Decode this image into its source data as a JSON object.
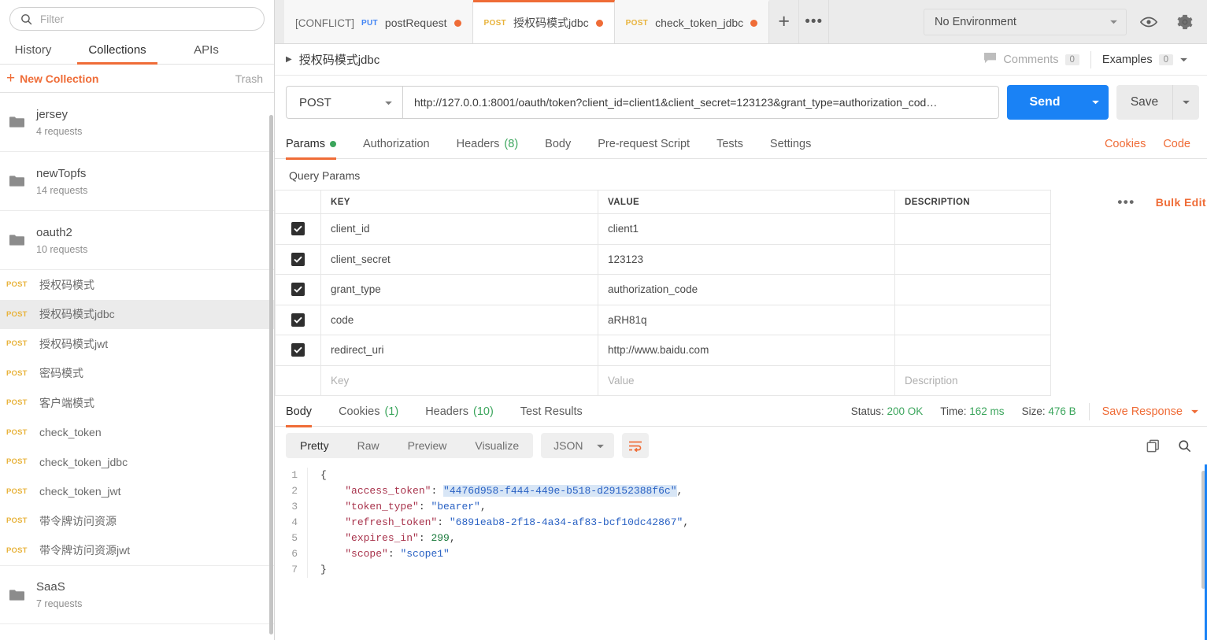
{
  "sidebar": {
    "filter_placeholder": "Filter",
    "tabs": [
      {
        "label": "History",
        "active": false
      },
      {
        "label": "Collections",
        "active": true
      },
      {
        "label": "APIs",
        "active": false
      }
    ],
    "new_collection_label": "New Collection",
    "trash_label": "Trash",
    "folders": [
      {
        "name": "jersey",
        "count": "4 requests"
      },
      {
        "name": "newTopfs",
        "count": "14 requests"
      },
      {
        "name": "oauth2",
        "count": "10 requests"
      }
    ],
    "requests": [
      {
        "method": "POST",
        "name": "授权码模式",
        "selected": false
      },
      {
        "method": "POST",
        "name": "授权码模式jdbc",
        "selected": true
      },
      {
        "method": "POST",
        "name": "授权码模式jwt",
        "selected": false
      },
      {
        "method": "POST",
        "name": "密码模式",
        "selected": false
      },
      {
        "method": "POST",
        "name": "客户端模式",
        "selected": false
      },
      {
        "method": "POST",
        "name": "check_token",
        "selected": false
      },
      {
        "method": "POST",
        "name": "check_token_jdbc",
        "selected": false
      },
      {
        "method": "POST",
        "name": "check_token_jwt",
        "selected": false
      },
      {
        "method": "POST",
        "name": "带令牌访问资源",
        "selected": false
      },
      {
        "method": "POST",
        "name": "带令牌访问资源jwt",
        "selected": false
      }
    ],
    "folders_after": [
      {
        "name": "SaaS",
        "count": "7 requests"
      }
    ]
  },
  "tabstrip": {
    "tabs": [
      {
        "prefix": "[CONFLICT]",
        "method": "PUT",
        "method_class": "put",
        "name": "postRequest",
        "active": false,
        "unsaved": true
      },
      {
        "prefix": "",
        "method": "POST",
        "method_class": "post",
        "name": "授权码模式jdbc",
        "active": true,
        "unsaved": true
      },
      {
        "prefix": "",
        "method": "POST",
        "method_class": "post",
        "name": "check_token_jdbc",
        "active": false,
        "unsaved": true
      }
    ],
    "add_tab_label": "+",
    "more_label": "•••",
    "environment": "No Environment"
  },
  "breadcrumb": {
    "title": "授权码模式jdbc",
    "comments_label": "Comments",
    "comments_count": "0",
    "examples_label": "Examples",
    "examples_count": "0"
  },
  "urlbar": {
    "method": "POST",
    "url": "http://127.0.0.1:8001/oauth/token?client_id=client1&client_secret=123123&grant_type=authorization_cod…",
    "send_label": "Send",
    "save_label": "Save"
  },
  "request_tabs": [
    {
      "label": "Params",
      "badge": "",
      "dot": true,
      "active": true
    },
    {
      "label": "Authorization",
      "badge": "",
      "dot": false,
      "active": false
    },
    {
      "label": "Headers",
      "badge": "(8)",
      "dot": false,
      "active": false
    },
    {
      "label": "Body",
      "badge": "",
      "dot": false,
      "active": false
    },
    {
      "label": "Pre-request Script",
      "badge": "",
      "dot": false,
      "active": false
    },
    {
      "label": "Tests",
      "badge": "",
      "dot": false,
      "active": false
    },
    {
      "label": "Settings",
      "badge": "",
      "dot": false,
      "active": false
    }
  ],
  "request_tabs_right": {
    "cookies": "Cookies",
    "code": "Code"
  },
  "params": {
    "section_label": "Query Params",
    "headers": {
      "key": "KEY",
      "value": "VALUE",
      "description": "DESCRIPTION"
    },
    "bulk_edit_label": "Bulk Edit",
    "rows": [
      {
        "checked": true,
        "key": "client_id",
        "value": "client1",
        "description": ""
      },
      {
        "checked": true,
        "key": "client_secret",
        "value": "123123",
        "description": ""
      },
      {
        "checked": true,
        "key": "grant_type",
        "value": "authorization_code",
        "description": ""
      },
      {
        "checked": true,
        "key": "code",
        "value": "aRH81q",
        "description": ""
      },
      {
        "checked": true,
        "key": "redirect_uri",
        "value": "http://www.baidu.com",
        "description": ""
      }
    ],
    "placeholder_row": {
      "key": "Key",
      "value": "Value",
      "description": "Description"
    }
  },
  "response": {
    "tabs": [
      {
        "label": "Body",
        "badge": "",
        "active": true
      },
      {
        "label": "Cookies",
        "badge": "(1)",
        "active": false
      },
      {
        "label": "Headers",
        "badge": "(10)",
        "active": false
      },
      {
        "label": "Test Results",
        "badge": "",
        "active": false
      }
    ],
    "status_label": "Status:",
    "status_value": "200 OK",
    "time_label": "Time:",
    "time_value": "162 ms",
    "size_label": "Size:",
    "size_value": "476 B",
    "save_response_label": "Save Response",
    "view_modes": [
      {
        "label": "Pretty",
        "active": true
      },
      {
        "label": "Raw",
        "active": false
      },
      {
        "label": "Preview",
        "active": false
      },
      {
        "label": "Visualize",
        "active": false
      }
    ],
    "format": "JSON",
    "body_lines": [
      {
        "n": "1",
        "indent": 0,
        "segs": [
          {
            "t": "pun",
            "v": "{"
          }
        ]
      },
      {
        "n": "2",
        "indent": 1,
        "segs": [
          {
            "t": "key",
            "v": "\"access_token\""
          },
          {
            "t": "pun",
            "v": ": "
          },
          {
            "t": "str-hl",
            "v": "\"4476d958-f444-449e-b518-d29152388f6c\""
          },
          {
            "t": "pun",
            "v": ","
          }
        ]
      },
      {
        "n": "3",
        "indent": 1,
        "segs": [
          {
            "t": "key",
            "v": "\"token_type\""
          },
          {
            "t": "pun",
            "v": ": "
          },
          {
            "t": "str",
            "v": "\"bearer\""
          },
          {
            "t": "pun",
            "v": ","
          }
        ]
      },
      {
        "n": "4",
        "indent": 1,
        "segs": [
          {
            "t": "key",
            "v": "\"refresh_token\""
          },
          {
            "t": "pun",
            "v": ": "
          },
          {
            "t": "str",
            "v": "\"6891eab8-2f18-4a34-af83-bcf10dc42867\""
          },
          {
            "t": "pun",
            "v": ","
          }
        ]
      },
      {
        "n": "5",
        "indent": 1,
        "segs": [
          {
            "t": "key",
            "v": "\"expires_in\""
          },
          {
            "t": "pun",
            "v": ": "
          },
          {
            "t": "num",
            "v": "299"
          },
          {
            "t": "pun",
            "v": ","
          }
        ]
      },
      {
        "n": "6",
        "indent": 1,
        "segs": [
          {
            "t": "key",
            "v": "\"scope\""
          },
          {
            "t": "pun",
            "v": ": "
          },
          {
            "t": "str",
            "v": "\"scope1\""
          }
        ]
      },
      {
        "n": "7",
        "indent": 0,
        "segs": [
          {
            "t": "pun",
            "v": "}"
          }
        ]
      }
    ]
  },
  "colors": {
    "accent": "#ef6c37",
    "send_blue": "#1a82f5",
    "method_post": "#e8b33c",
    "method_put": "#4285f4",
    "success_green": "#3ba55c"
  }
}
